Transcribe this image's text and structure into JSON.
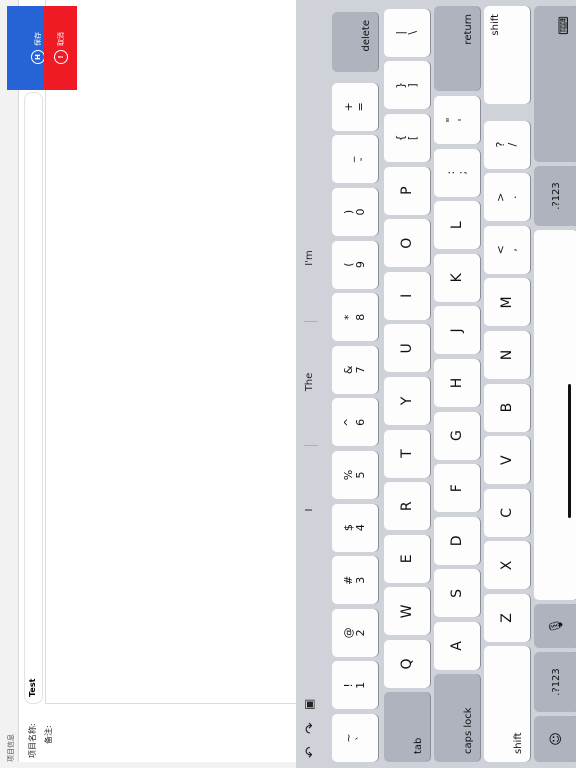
{
  "form": {
    "section_label": "项目信息",
    "name_label": "项目名称:",
    "name_value": "Test",
    "memo_label": "备注:"
  },
  "actions": {
    "save_label": "保存",
    "save_icon_letter": "H",
    "cancel_label": "取消",
    "cancel_icon_letter": "!"
  },
  "keyboard": {
    "suggestions": [
      "I",
      "The",
      "I'm"
    ],
    "row1": [
      {
        "top": "~",
        "bottom": "`"
      },
      {
        "top": "!",
        "bottom": "1"
      },
      {
        "top": "@",
        "bottom": "2"
      },
      {
        "top": "#",
        "bottom": "3"
      },
      {
        "top": "$",
        "bottom": "4"
      },
      {
        "top": "%",
        "bottom": "5"
      },
      {
        "top": "^",
        "bottom": "6"
      },
      {
        "top": "&",
        "bottom": "7"
      },
      {
        "top": "*",
        "bottom": "8"
      },
      {
        "top": "(",
        "bottom": "9"
      },
      {
        "top": ")",
        "bottom": "0"
      },
      {
        "top": "_",
        "bottom": "-"
      },
      {
        "top": "+",
        "bottom": "="
      }
    ],
    "delete_label": "delete",
    "tab_label": "tab",
    "row2": [
      "Q",
      "W",
      "E",
      "R",
      "T",
      "Y",
      "U",
      "I",
      "O",
      "P"
    ],
    "row2_extra": [
      {
        "top": "{",
        "bottom": "["
      },
      {
        "top": "}",
        "bottom": "]"
      },
      {
        "top": "|",
        "bottom": "\\"
      }
    ],
    "caps_label": "caps lock",
    "row3": [
      "A",
      "S",
      "D",
      "F",
      "G",
      "H",
      "J",
      "K",
      "L"
    ],
    "row3_extra": [
      {
        "top": ":",
        "bottom": ";"
      },
      {
        "top": "\"",
        "bottom": "'"
      }
    ],
    "return_label": "return",
    "shift_label": "shift",
    "row4": [
      "Z",
      "X",
      "C",
      "V",
      "B",
      "N",
      "M"
    ],
    "row4_extra": [
      {
        "top": "<",
        "bottom": ","
      },
      {
        "top": ">",
        "bottom": "."
      },
      {
        "top": "?",
        "bottom": "/"
      }
    ],
    "numbers_label": ".?123",
    "icons": {
      "undo": "undo-icon",
      "redo": "redo-icon",
      "paste": "clipboard-icon",
      "emoji": "emoji-icon",
      "mic": "microphone-icon",
      "dismiss": "keyboard-dismiss-icon"
    }
  }
}
